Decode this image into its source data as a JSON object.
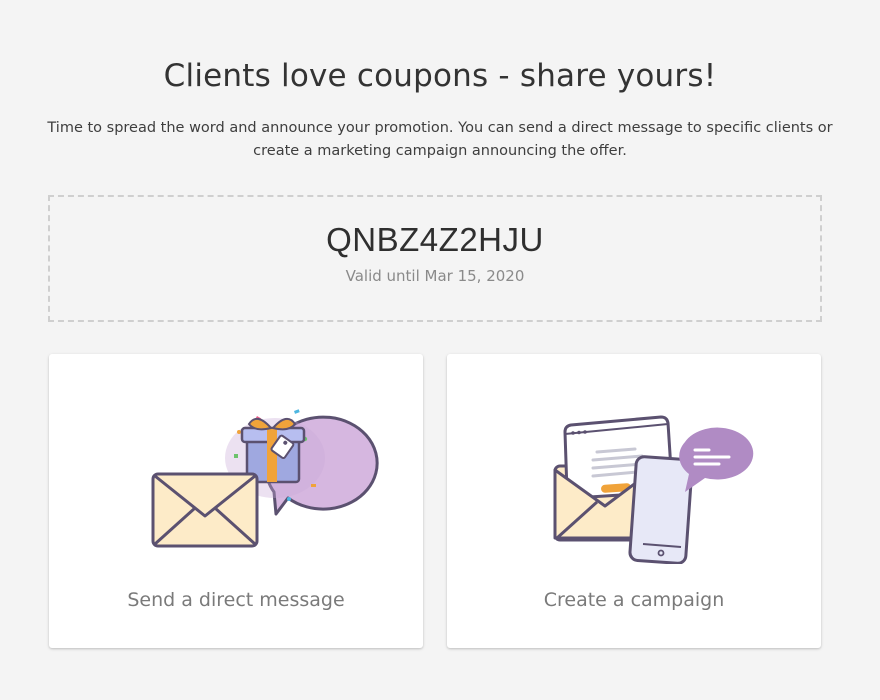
{
  "header": {
    "title": "Clients love coupons - share yours!",
    "description": "Time to spread the word and announce your promotion. You can send a direct message to specific clients or create a marketing campaign announcing the offer."
  },
  "coupon": {
    "code": "QNBZ4Z2HJU",
    "validity": "Valid until Mar 15, 2020"
  },
  "actions": [
    {
      "label": "Send a direct message",
      "icon": "envelope-gift-icon"
    },
    {
      "label": "Create a campaign",
      "icon": "campaign-devices-icon"
    }
  ],
  "colors": {
    "background": "#f4f4f4",
    "outline": "#5b5170",
    "envelope": "#fdebc8",
    "bubble": "#c9a8d6",
    "gift_ribbon": "#f0a33a",
    "phone_screen": "#e7e8f7"
  }
}
